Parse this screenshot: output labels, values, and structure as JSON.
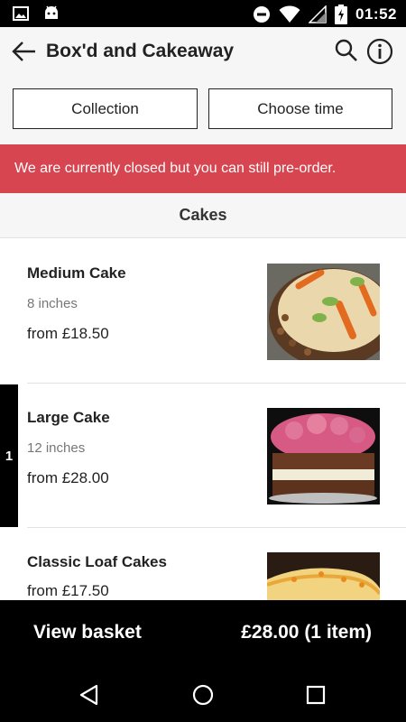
{
  "status_bar": {
    "time": "01:52",
    "icons": [
      "image-icon",
      "android-icon",
      "do-not-disturb-icon",
      "wifi-icon",
      "signal-icon",
      "battery-icon"
    ]
  },
  "header": {
    "title": "Box'd and Cakeaway",
    "back_icon": "back-arrow-icon",
    "search_icon": "search-icon",
    "info_icon": "info-icon"
  },
  "filters": {
    "collection_label": "Collection",
    "time_label": "Choose time"
  },
  "banner": {
    "text": "We are currently closed but you can still pre-order.",
    "color": "#d64550"
  },
  "section": {
    "title": "Cakes"
  },
  "items": [
    {
      "name": "Medium Cake",
      "size": "8 inches",
      "price": "from £18.50",
      "image": "carrot-cake-photo"
    },
    {
      "name": "Large Cake",
      "size": "12 inches",
      "price": "from £28.00",
      "image": "pink-frosted-cake-photo",
      "quantity": "1"
    },
    {
      "name": "Classic Loaf Cakes",
      "price": "from £17.50",
      "image": "loaf-cake-photo"
    }
  ],
  "basket": {
    "label": "View basket",
    "total": "£28.00 (1 item)"
  },
  "nav": {
    "icons": [
      "back-triangle-icon",
      "home-circle-icon",
      "recents-square-icon"
    ]
  }
}
